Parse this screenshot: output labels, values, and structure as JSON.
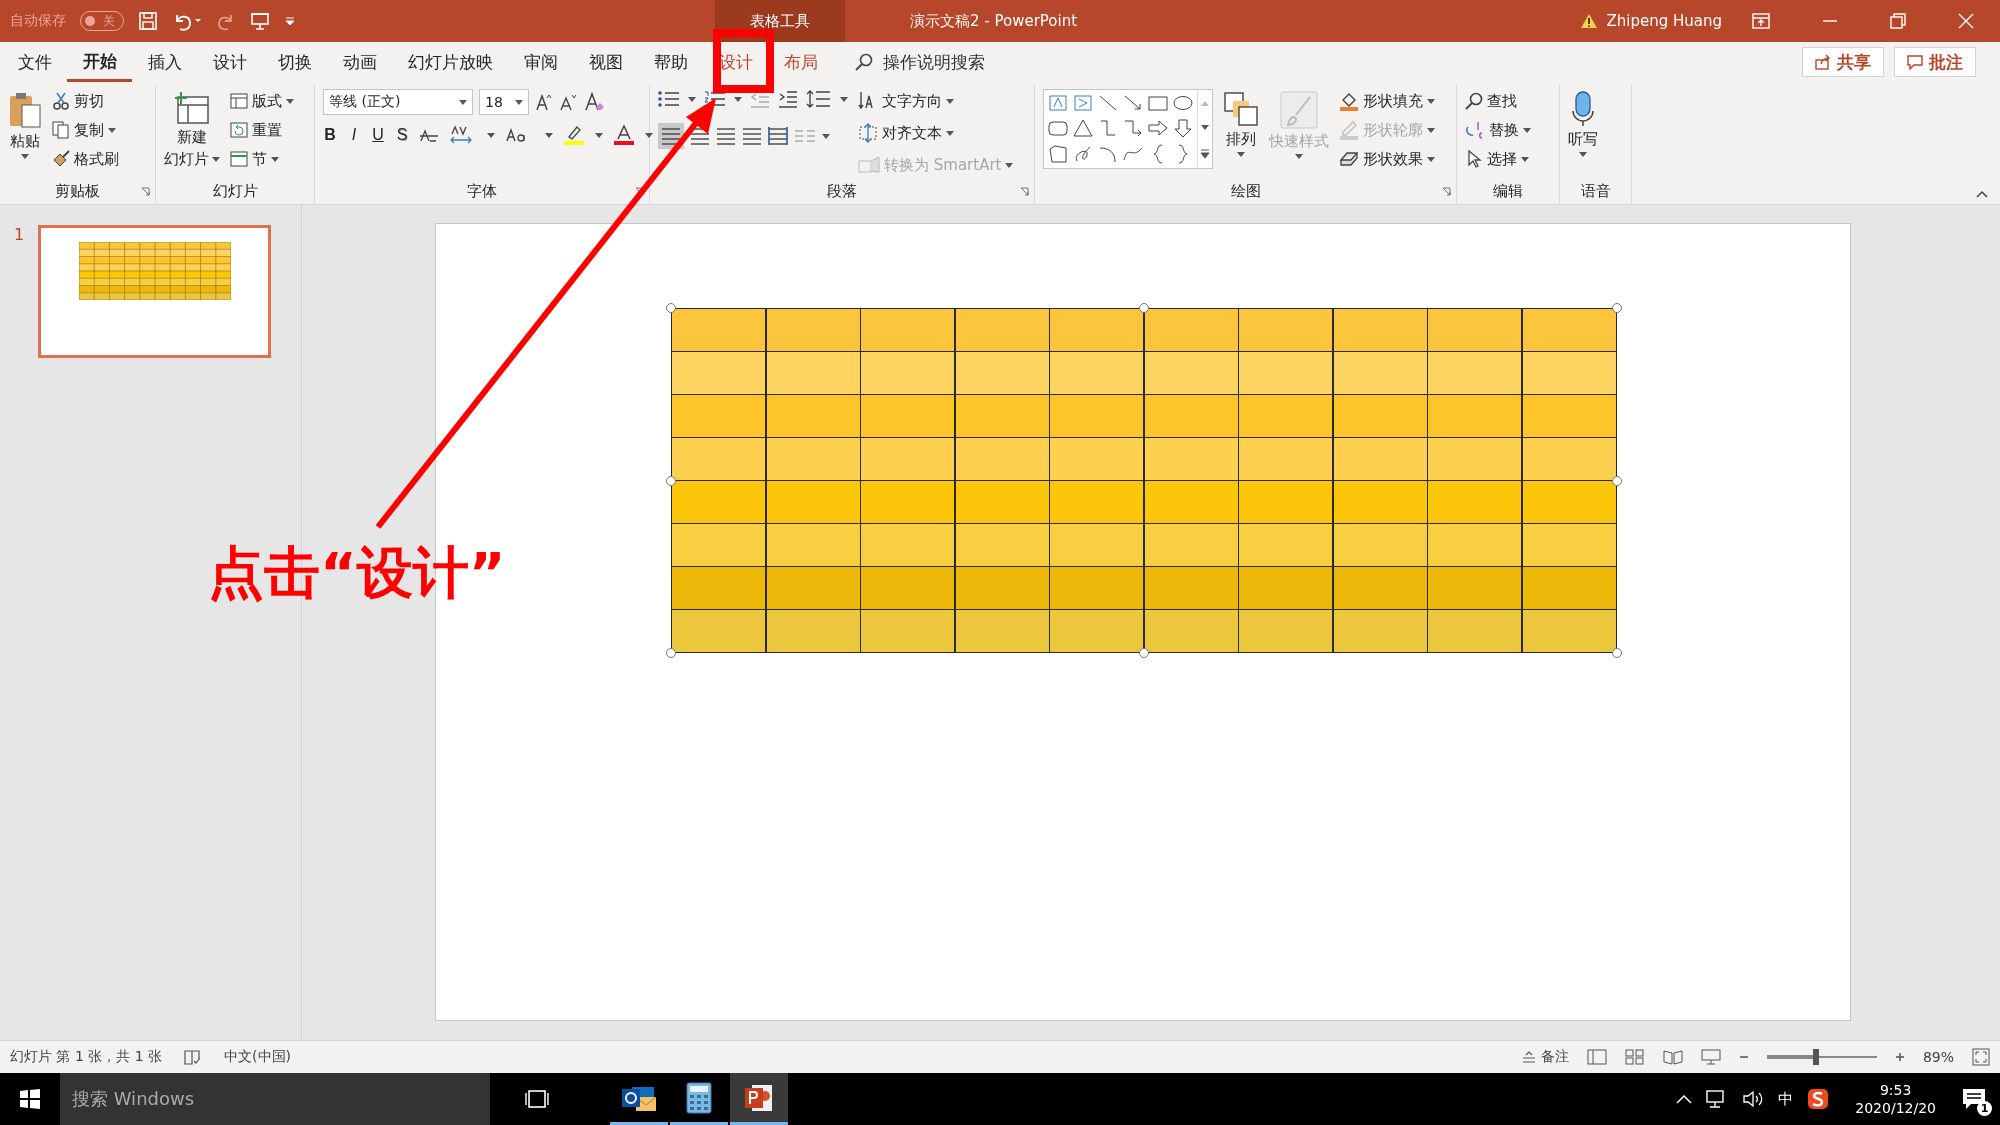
{
  "quick_access": {
    "autosave_label": "自动保存",
    "autosave_toggle": {
      "label": "关",
      "on": false
    }
  },
  "window": {
    "context_tab_group": "表格工具",
    "title": "演示文稿2  -  PowerPoint",
    "user": "Zhipeng Huang"
  },
  "tabs": [
    {
      "label": "文件",
      "selected": false,
      "kind": "normal"
    },
    {
      "label": "开始",
      "selected": true,
      "kind": "normal"
    },
    {
      "label": "插入",
      "selected": false,
      "kind": "normal"
    },
    {
      "label": "设计",
      "selected": false,
      "kind": "normal"
    },
    {
      "label": "切换",
      "selected": false,
      "kind": "normal"
    },
    {
      "label": "动画",
      "selected": false,
      "kind": "normal"
    },
    {
      "label": "幻灯片放映",
      "selected": false,
      "kind": "normal"
    },
    {
      "label": "审阅",
      "selected": false,
      "kind": "normal"
    },
    {
      "label": "视图",
      "selected": false,
      "kind": "normal"
    },
    {
      "label": "帮助",
      "selected": false,
      "kind": "normal"
    },
    {
      "label": "设计",
      "selected": false,
      "kind": "context"
    },
    {
      "label": "布局",
      "selected": false,
      "kind": "context"
    }
  ],
  "tell_me": "操作说明搜索",
  "share_button": "共享",
  "comments_button": "批注",
  "ribbon": {
    "clipboard": {
      "title": "剪贴板",
      "paste": "粘贴",
      "items": [
        "剪切",
        "复制",
        "格式刷"
      ]
    },
    "slides": {
      "title": "幻灯片",
      "new_slide": [
        "新建",
        "幻灯片"
      ],
      "items": [
        "版式",
        "重置",
        "节"
      ]
    },
    "font": {
      "title": "字体",
      "font_name": "等线 (正文)",
      "font_size": "18",
      "style_buttons": [
        "B",
        "I",
        "U",
        "S"
      ]
    },
    "paragraph": {
      "title": "段落",
      "items": [
        {
          "label": "文字方向",
          "disabled": false
        },
        {
          "label": "对齐文本",
          "disabled": false
        },
        {
          "label": "转换为 SmartArt",
          "disabled": true
        }
      ]
    },
    "drawing": {
      "title": "绘图",
      "arrange": "排列",
      "quick_styles": {
        "label": "快速样式",
        "disabled": true
      },
      "items": [
        {
          "label": "形状填充",
          "disabled": false
        },
        {
          "label": "形状轮廓",
          "disabled": true
        },
        {
          "label": "形状效果",
          "disabled": false
        }
      ]
    },
    "editing": {
      "title": "编辑",
      "items": [
        "查找",
        "替换",
        "选择"
      ]
    },
    "voice": {
      "title": "语音",
      "dictate": "听写"
    }
  },
  "thumbnails": [
    {
      "number": "1",
      "selected": true
    }
  ],
  "slide": {
    "table": {
      "rows": [
        {
          "color": "#fcc53e"
        },
        {
          "color": "#fdd45f"
        },
        {
          "color": "#fdc52a"
        },
        {
          "color": "#fdd050"
        },
        {
          "color": "#fcc60a"
        },
        {
          "color": "#f7cf40"
        },
        {
          "color": "#edb80a"
        },
        {
          "color": "#ecc63c"
        }
      ]
    }
  },
  "status_bar": {
    "slide_info": "幻灯片 第 1 张，共 1 张",
    "language": "中文(中国)",
    "notes": "备注",
    "zoom_slider": {
      "level": 0.45
    },
    "zoom": "89%"
  },
  "taskbar": {
    "search_placeholder": "搜索 Windows",
    "apps": [
      {
        "kind": "outlook",
        "selected": false
      },
      {
        "kind": "calculator",
        "selected": false
      },
      {
        "kind": "powerpoint",
        "selected": true
      }
    ],
    "ime": "中",
    "time": "9:53",
    "date": "2020/12/20",
    "notifications": "1"
  },
  "annotation": {
    "text": "点击“设计”"
  }
}
